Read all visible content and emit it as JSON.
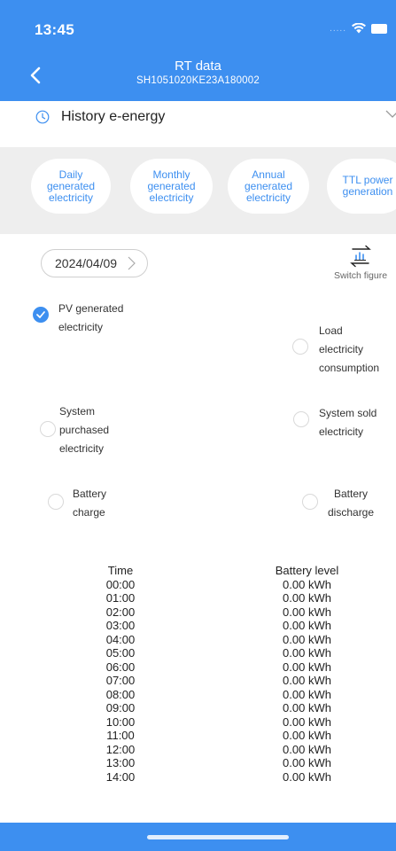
{
  "status_bar": {
    "time": "13:45",
    "signal": "....."
  },
  "header": {
    "title": "RT data",
    "subtitle": "SH1051020KE23A180002"
  },
  "history": {
    "label": "History e-energy"
  },
  "tabs": [
    {
      "label": "Daily generated electricity",
      "lines": [
        "Daily",
        "generated",
        "electricity"
      ],
      "active": true
    },
    {
      "label": "Monthly generated electricity",
      "lines": [
        "Monthly",
        "generated",
        "electricity"
      ],
      "active": false
    },
    {
      "label": "Annual generated electricity",
      "lines": [
        "Annual",
        "generated",
        "electricity"
      ],
      "active": false
    },
    {
      "label": "TTL power generation",
      "lines": [
        "TTL power",
        "generation"
      ],
      "active": false
    }
  ],
  "date": {
    "value": "2024/04/09"
  },
  "switch_figure": {
    "label": "Switch figure"
  },
  "options": [
    {
      "lines": [
        "PV generated",
        "electricity"
      ],
      "checked": true
    },
    {
      "lines": [
        "Load",
        "electricity",
        "consumption"
      ],
      "checked": false
    },
    {
      "lines": [
        "System",
        "purchased",
        "electricity"
      ],
      "checked": false
    },
    {
      "lines": [
        "System sold",
        "electricity"
      ],
      "checked": false
    },
    {
      "lines": [
        "Battery",
        "charge"
      ],
      "checked": false
    },
    {
      "lines": [
        "Battery",
        "discharge"
      ],
      "checked": false
    }
  ],
  "table": {
    "headers": [
      "Time",
      "Battery level"
    ],
    "rows": [
      [
        "00:00",
        "0.00 kWh"
      ],
      [
        "01:00",
        "0.00 kWh"
      ],
      [
        "02:00",
        "0.00 kWh"
      ],
      [
        "03:00",
        "0.00 kWh"
      ],
      [
        "04:00",
        "0.00 kWh"
      ],
      [
        "05:00",
        "0.00 kWh"
      ],
      [
        "06:00",
        "0.00 kWh"
      ],
      [
        "07:00",
        "0.00 kWh"
      ],
      [
        "08:00",
        "0.00 kWh"
      ],
      [
        "09:00",
        "0.00 kWh"
      ],
      [
        "10:00",
        "0.00 kWh"
      ],
      [
        "11:00",
        "0.00 kWh"
      ],
      [
        "12:00",
        "0.00 kWh"
      ],
      [
        "13:00",
        "0.00 kWh"
      ],
      [
        "14:00",
        "0.00 kWh"
      ]
    ]
  },
  "colors": {
    "accent": "#3d8ff0",
    "tabs_background": "#eeeeee"
  }
}
